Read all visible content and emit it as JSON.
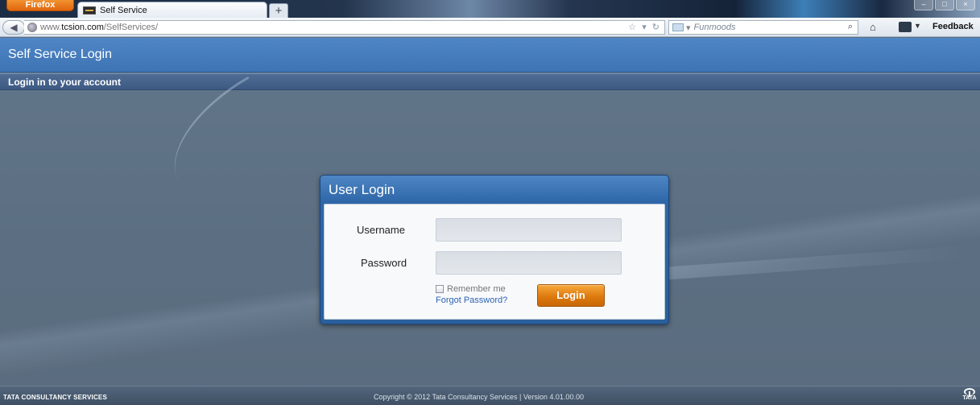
{
  "browser": {
    "app_button": "Firefox",
    "tab_title": "Self Service",
    "new_tab": "+",
    "url_prefix": "www.",
    "url_host": "tcsion.com",
    "url_path": "/SelfServices/",
    "search_placeholder": "Funmoods",
    "feedback": "Feedback"
  },
  "page": {
    "header_title": "Self Service Login",
    "sub_header": "Login in to your account"
  },
  "login": {
    "title": "User Login",
    "username_label": "Username",
    "password_label": "Password",
    "username_value": "",
    "password_value": "",
    "remember_label": "Remember me",
    "forgot_link": "Forgot Password?",
    "login_button": "Login"
  },
  "footer": {
    "company": "TATA CONSULTANCY SERVICES",
    "copyright": "Copyright © 2012 Tata Consultancy Services | Version 4.01.00.00",
    "logo_text": "TATA"
  },
  "colors": {
    "header_blue": "#4a80c0",
    "page_bg": "#5d7082",
    "login_orange": "#e3820f",
    "link_blue": "#2e63b3"
  }
}
